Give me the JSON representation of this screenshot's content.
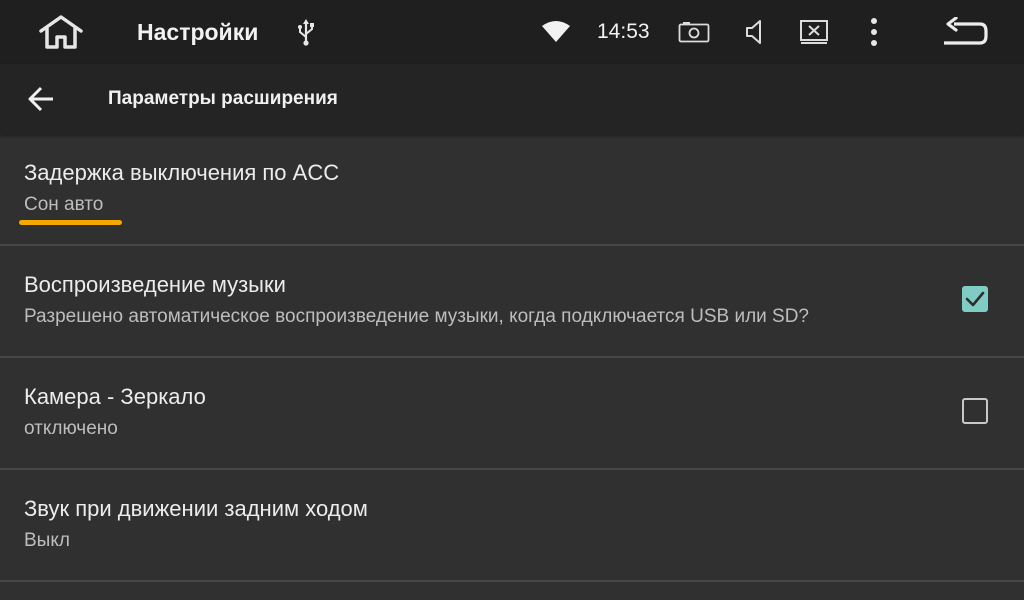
{
  "statusbar": {
    "title": "Настройки",
    "time": "14:53",
    "icons": [
      "home-icon",
      "usb-icon",
      "wifi-icon",
      "screenshot-icon",
      "volume-icon",
      "close-window-icon",
      "more-vert-icon",
      "back-return-icon"
    ]
  },
  "appbar": {
    "title": "Параметры расширения",
    "back_icon": "arrow-back-icon"
  },
  "settings": [
    {
      "title": "Задержка выключения по ACC",
      "summary": "Сон авто",
      "checkbox": null
    },
    {
      "title": "Воспроизведение музыки",
      "summary": "Разрешено автоматическое воспроизведение музыки, когда подключается USB или SD?",
      "checkbox": true
    },
    {
      "title": "Камера - Зеркало",
      "summary": "отключено",
      "checkbox": false
    },
    {
      "title": "Звук при движении задним ходом",
      "summary": "Выкл",
      "checkbox": null
    }
  ],
  "colors": {
    "statusbar_bg": "#1f1f1f",
    "appbar_bg": "#242424",
    "page_bg": "#303030",
    "accent_checkbox": "#80cbc4",
    "highlight_underline": "#f5a800"
  }
}
